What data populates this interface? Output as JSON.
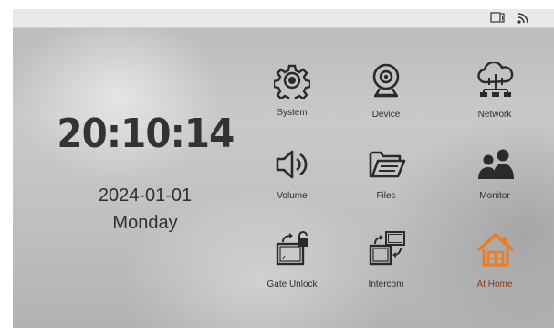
{
  "clock": {
    "time": "20:10:14",
    "date": "2024-01-01",
    "weekday": "Monday"
  },
  "status_bar": {
    "icons": [
      "sd-card-icon",
      "wifi-icon"
    ]
  },
  "menu": [
    {
      "id": "system",
      "label": "System",
      "icon": "gear-icon"
    },
    {
      "id": "device",
      "label": "Device",
      "icon": "webcam-icon"
    },
    {
      "id": "network",
      "label": "Network",
      "icon": "cloud-network-icon"
    },
    {
      "id": "volume",
      "label": "Volume",
      "icon": "speaker-icon"
    },
    {
      "id": "files",
      "label": "Files",
      "icon": "folder-icon"
    },
    {
      "id": "monitor",
      "label": "Monitor",
      "icon": "users-icon"
    },
    {
      "id": "gate_unlock",
      "label": "Gate Unlock",
      "icon": "gate-unlock-icon"
    },
    {
      "id": "intercom",
      "label": "Intercom",
      "icon": "intercom-icon"
    },
    {
      "id": "at_home",
      "label": "At Home",
      "icon": "home-icon"
    }
  ],
  "colors": {
    "icon_dark": "#2a2a2a",
    "home_accent": "#f07a1f"
  }
}
